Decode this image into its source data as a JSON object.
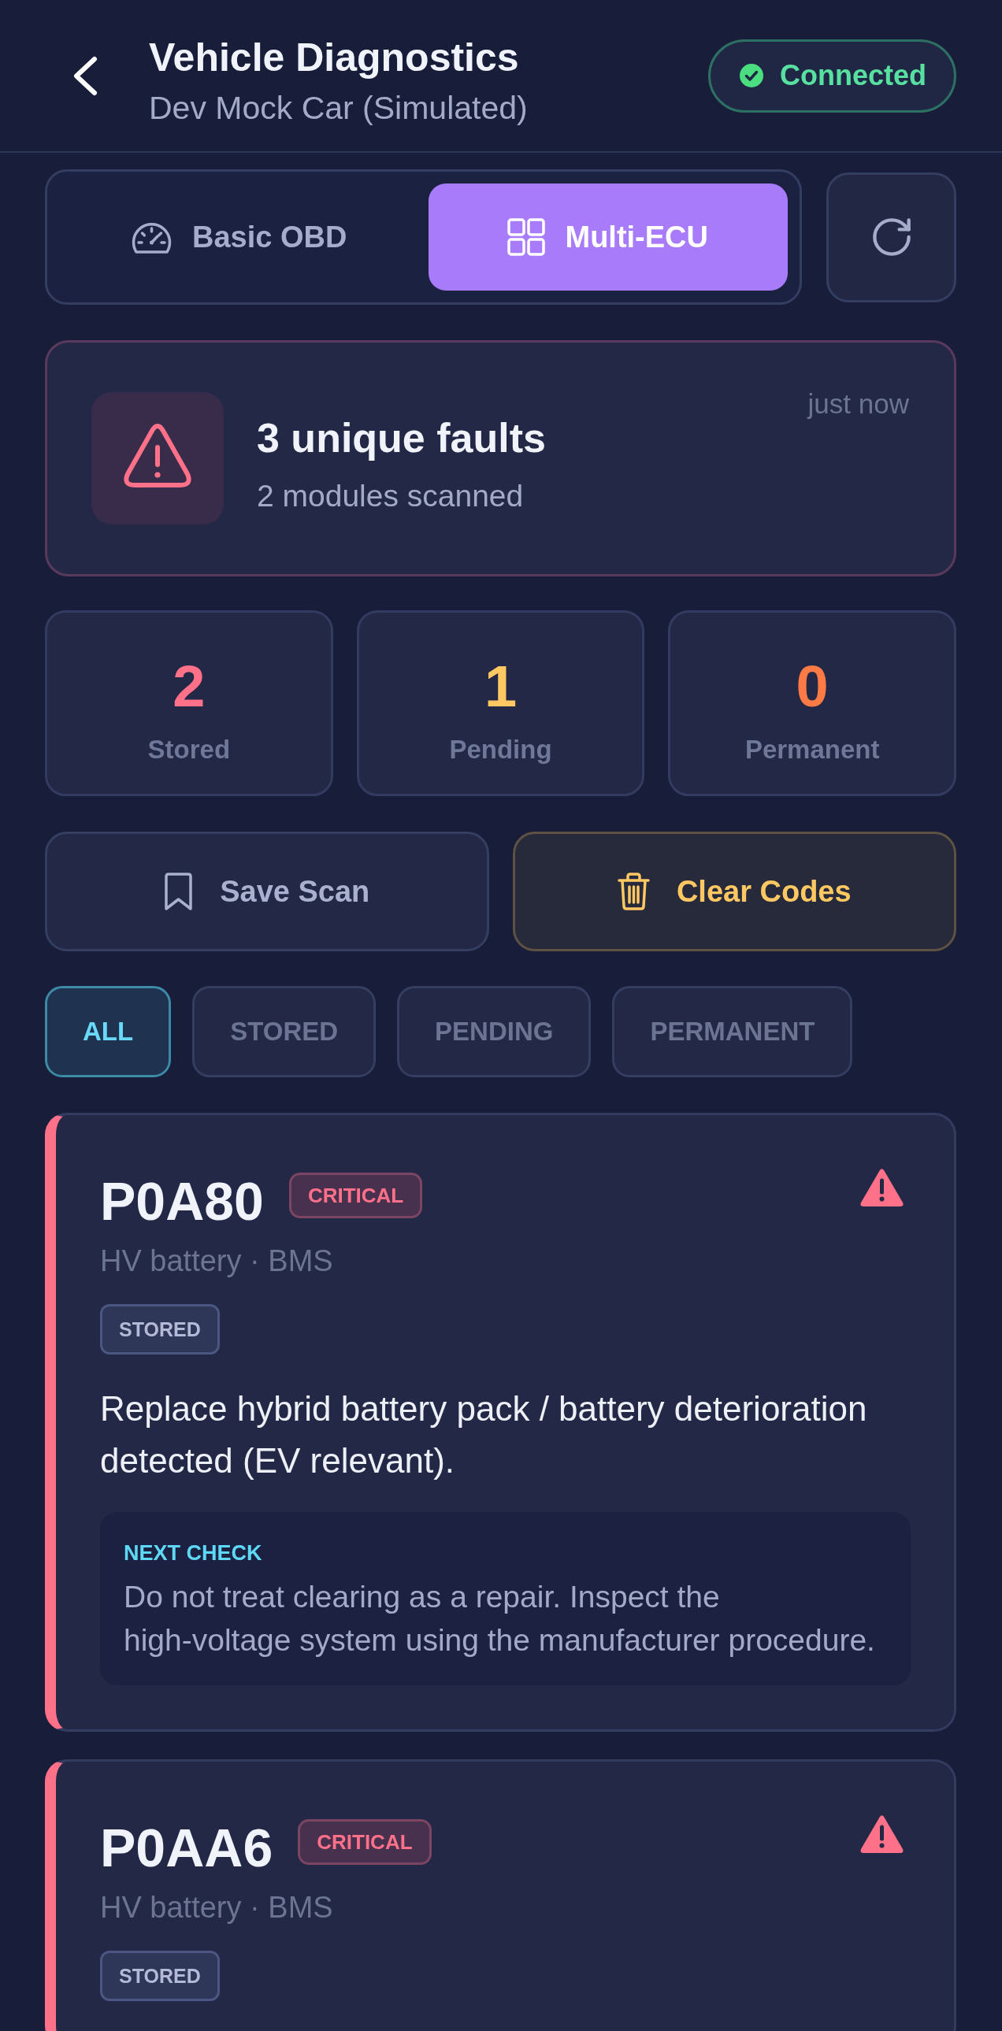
{
  "header": {
    "title": "Vehicle Diagnostics",
    "subtitle": "Dev Mock Car (Simulated)",
    "status": {
      "label": "Connected",
      "connected": true
    }
  },
  "mode_tabs": [
    {
      "label": "Basic OBD",
      "kind": "basic",
      "selected": false
    },
    {
      "label": "Multi-ECU",
      "kind": "multi",
      "selected": true
    }
  ],
  "summary": {
    "title": "3 unique faults",
    "subtitle": "2 modules scanned",
    "time": "just now"
  },
  "stats": [
    {
      "value": "2",
      "label": "Stored",
      "color": "#ff7089"
    },
    {
      "value": "1",
      "label": "Pending",
      "color": "#ffc862"
    },
    {
      "value": "0",
      "label": "Permanent",
      "color": "#ff7a45"
    }
  ],
  "actions": [
    {
      "label": "Save Scan",
      "kind": "save"
    },
    {
      "label": "Clear Codes",
      "kind": "clear"
    }
  ],
  "filters": [
    {
      "label": "ALL",
      "selected": true
    },
    {
      "label": "STORED",
      "selected": false
    },
    {
      "label": "PENDING",
      "selected": false
    },
    {
      "label": "PERMANENT",
      "selected": false
    }
  ],
  "faults": [
    {
      "code": "P0A80",
      "severity": "CRITICAL",
      "kind": "critical",
      "source": "HV battery · BMS",
      "status": "STORED",
      "description": "Replace hybrid battery pack / battery deterioration detected (EV relevant).",
      "next_check": {
        "label": "NEXT CHECK",
        "text": "Do not treat clearing as a repair. Inspect the high-voltage system using the manufacturer procedure."
      }
    },
    {
      "code": "P0AA6",
      "severity": "CRITICAL",
      "kind": "critical",
      "source": "HV battery · BMS",
      "status": "STORED"
    }
  ]
}
